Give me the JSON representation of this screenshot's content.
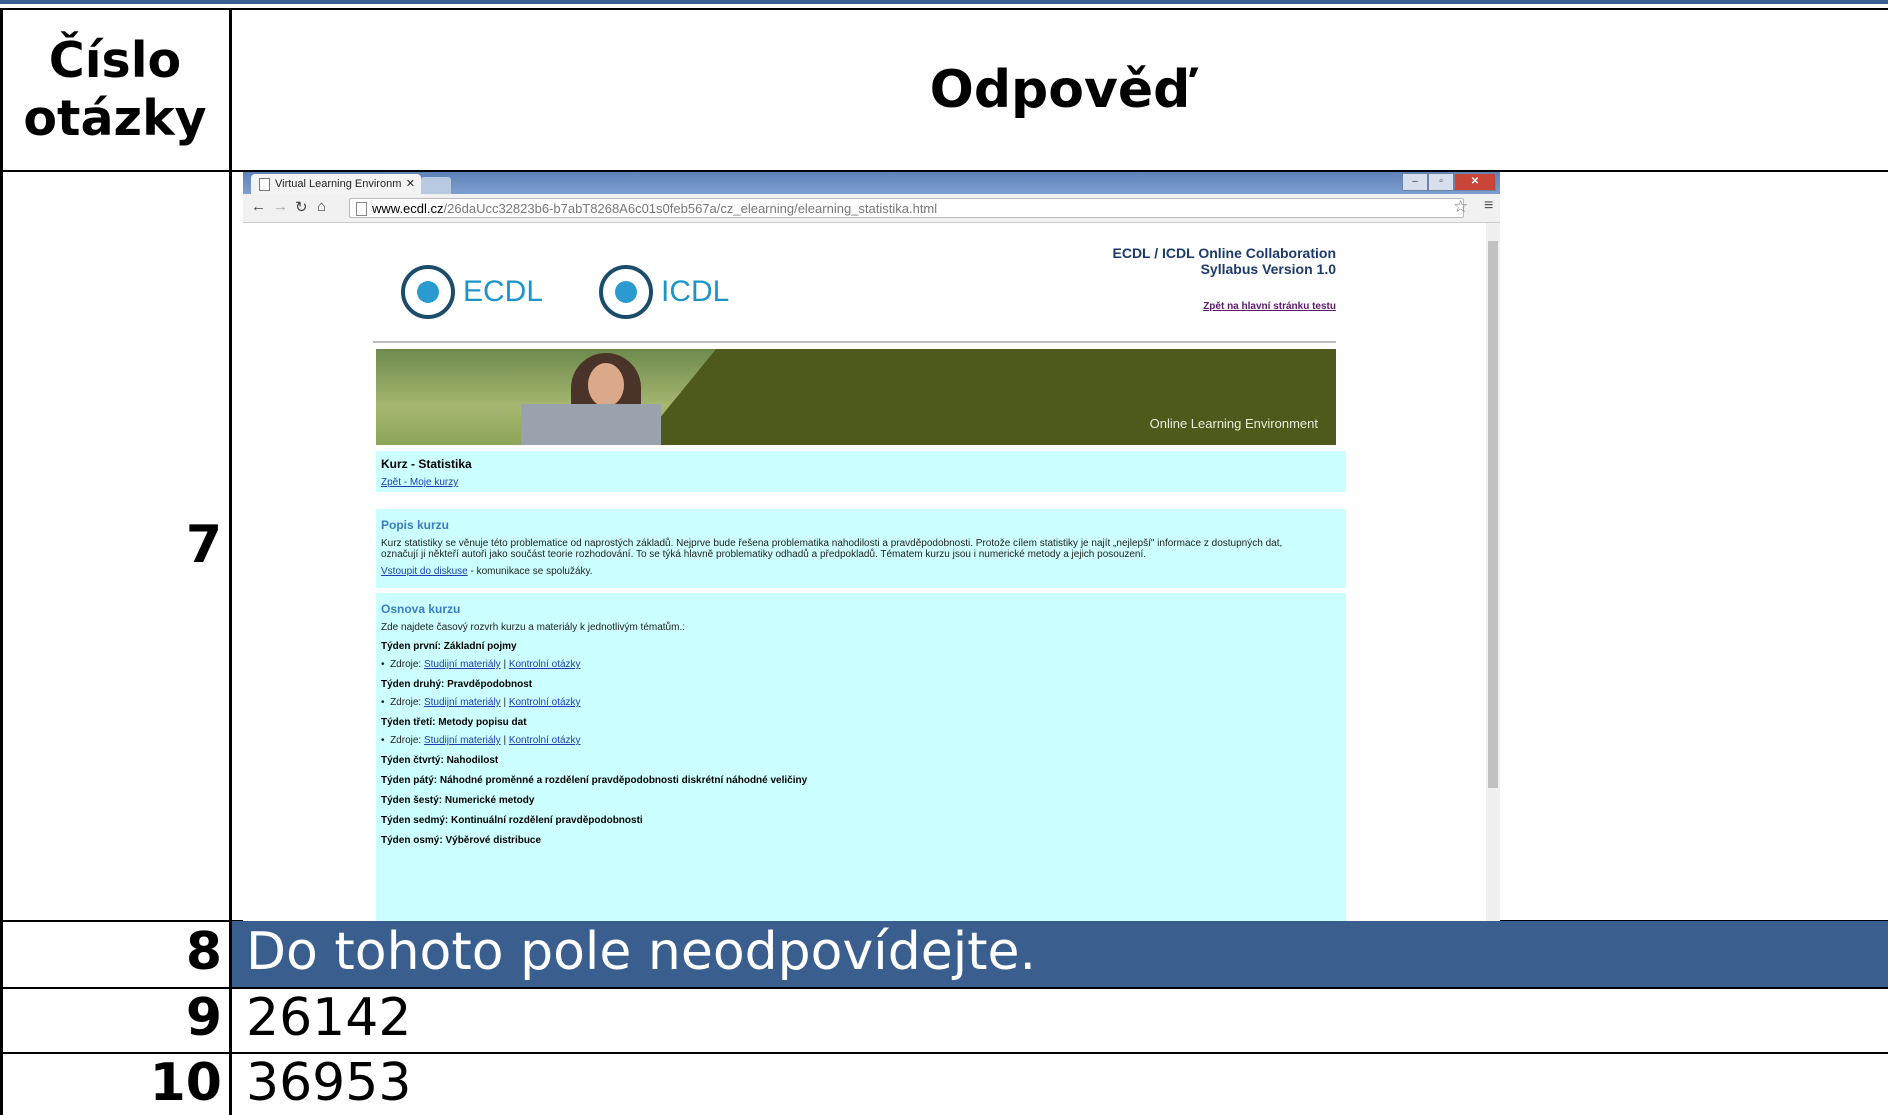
{
  "header": {
    "num_line1": "Číslo",
    "num_line2": "otázky",
    "answer": "Odpověď"
  },
  "rows": [
    {
      "num": "7"
    },
    {
      "num": "8",
      "answer": "Do tohoto pole neodpovídejte."
    },
    {
      "num": "9",
      "answer": "26142"
    },
    {
      "num": "10",
      "answer": "36953"
    }
  ],
  "browser": {
    "tab_title": "Virtual Learning Environm",
    "url_host": "www.ecdl.cz",
    "url_path": "/26daUcc32823b6-b7abT8268A6c01s0feb567a/cz_elearning/elearning_statistika.html",
    "logo1": "ECDL",
    "logo2": "ICDL",
    "title_line1": "ECDL / ICDL Online Collaboration",
    "title_line2": "Syllabus Version 1.0",
    "back_link": "Zpět na hlavní stránku testu",
    "banner_text": "Online Learning Environment",
    "course_title": "Kurz - Statistika",
    "my_courses": "Zpět - Moje kurzy",
    "desc_heading": "Popis kurzu",
    "desc_text1": "Kurz statistiky se věnuje této problematice od naprostých základů. Nejprve bude řešena problematika nahodilosti a pravděpodobnosti. Protože cílem statistiky je najít „nejlepší\" informace z dostupných dat,",
    "desc_text2": "označují ji někteří autoři jako součást teorie rozhodování. To se týká hlavně problematiky odhadů a předpokladů. Tématem kurzu jsou i numerické metody a jejich posouzení.",
    "discuss_link": "Vstoupit do diskuse",
    "discuss_text": " - komunikace se spolužáky.",
    "outline_heading": "Osnova kurzu",
    "outline_intro": "Zde najdete časový rozvrh kurzu a materiály k jednotlivým tématům.:",
    "weeks": [
      {
        "label": "Týden první:",
        "topic": " Základní pojmy"
      },
      {
        "label": "Týden druhý:",
        "topic": " Pravděpodobnost"
      },
      {
        "label": "Týden třetí:",
        "topic": " Metody popisu dat"
      },
      {
        "label": "Týden čtvrtý:",
        "topic": " Nahodilost"
      },
      {
        "label": "Týden pátý:",
        "topic": " Náhodné proměnné a rozdělení pravděpodobnosti diskrétní náhodné veličiny"
      },
      {
        "label": "Týden šestý:",
        "topic": " Numerické metody"
      },
      {
        "label": "Týden sedmý:",
        "topic": " Kontinuální rozdělení pravděpodobnosti"
      },
      {
        "label": "Týden osmý:",
        "topic": " Výběrové distribuce"
      }
    ],
    "res_prefix": "Zdroje: ",
    "res_link1": "Studijní materiály",
    "res_sep": " | ",
    "res_link2": "Kontrolní otázky"
  }
}
